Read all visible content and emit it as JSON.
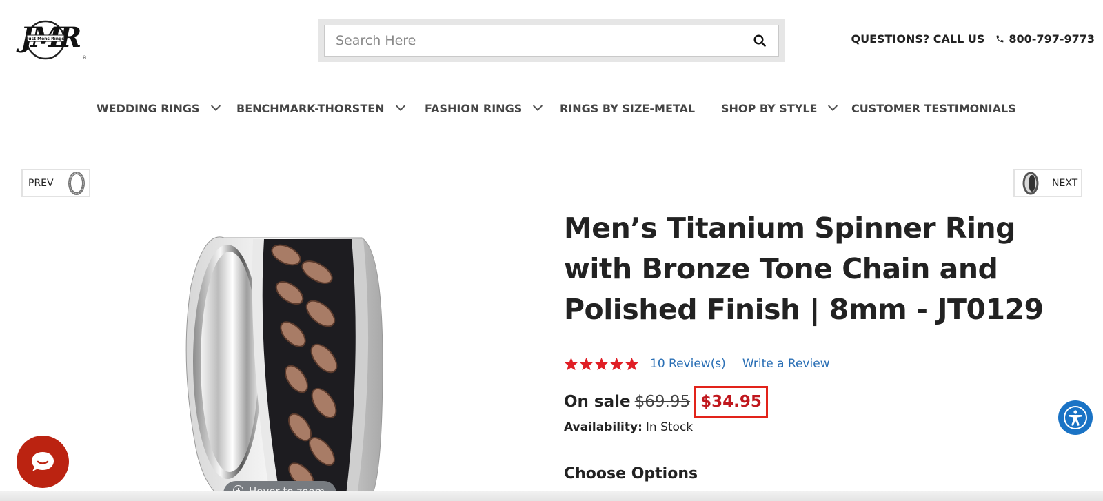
{
  "header": {
    "logo_text": "JMR",
    "logo_subtext": "Just Mens Rings",
    "search": {
      "placeholder": "Search Here",
      "value": ""
    },
    "call_label": "QUESTIONS? CALL US",
    "phone": "800-797-9773"
  },
  "nav": {
    "items": [
      {
        "label": "WEDDING RINGS",
        "has_dropdown": true
      },
      {
        "label": "BENCHMARK-THORSTEN",
        "has_dropdown": true
      },
      {
        "label": "FASHION RINGS",
        "has_dropdown": true
      },
      {
        "label": "RINGS BY SIZE-METAL",
        "has_dropdown": false
      },
      {
        "label": "SHOP BY STYLE",
        "has_dropdown": true
      },
      {
        "label": "CUSTOMER TESTIMONIALS",
        "has_dropdown": false
      }
    ]
  },
  "pager": {
    "prev_label": "PREV",
    "next_label": "NEXT"
  },
  "product": {
    "title": "Men’s Titanium Spinner Ring with Bronze Tone Chain and Polished Finish | 8mm - JT0129",
    "rating": 5,
    "reviews_link": "10 Review(s)",
    "write_review_link": "Write a Review",
    "on_sale_label": "On sale",
    "old_price": "$69.95",
    "new_price": "$34.95",
    "availability_label": "Availability:",
    "availability_value": "In Stock",
    "choose_options_label": "Choose Options",
    "zoom_hint": "Hover to zoom"
  },
  "colors": {
    "price_red": "#c0171d",
    "highlight_border": "#e2231a",
    "link_blue": "#2a6fb5",
    "chat_red": "#bb2311",
    "accessibility_blue": "#1a73c5",
    "star_red": "#e01e25"
  },
  "icons": [
    "search-icon",
    "phone-icon",
    "chevron-down-icon",
    "star-icon",
    "zoom-in-icon",
    "chat-icon",
    "accessibility-icon"
  ]
}
